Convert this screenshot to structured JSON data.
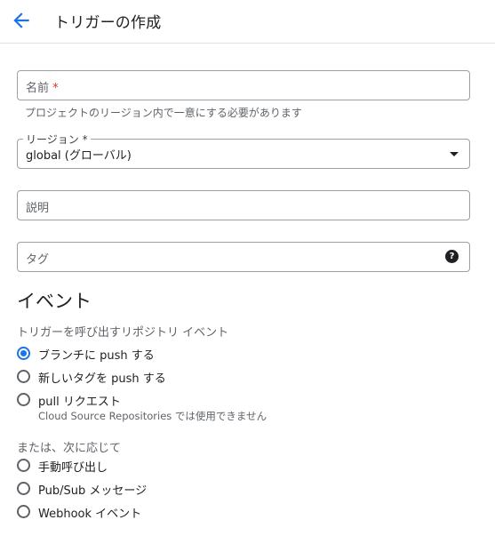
{
  "header": {
    "title": "トリガーの作成"
  },
  "form": {
    "name_placeholder": "名前",
    "required_mark": "*",
    "name_hint": "プロジェクトのリージョン内で一意にする必要があります",
    "region_label": "リージョン *",
    "region_value": "global (グローバル)",
    "description_placeholder": "説明",
    "tags_placeholder": "タグ",
    "help_glyph": "?"
  },
  "event": {
    "title": "イベント",
    "repo_events_label": "トリガーを呼び出すリポジトリ イベント",
    "options": [
      {
        "label": "ブランチに push する",
        "checked": true
      },
      {
        "label": "新しいタグを push する",
        "checked": false
      },
      {
        "label": "pull リクエスト",
        "checked": false,
        "sub": "Cloud Source Repositories では使用できません"
      }
    ],
    "or_label": "または、次に応じて",
    "other_options": [
      {
        "label": "手動呼び出し",
        "checked": false
      },
      {
        "label": "Pub/Sub メッセージ",
        "checked": false
      },
      {
        "label": "Webhook イベント",
        "checked": false
      }
    ]
  },
  "colors": {
    "accent": "#1a73e8",
    "required": "#d93025"
  }
}
